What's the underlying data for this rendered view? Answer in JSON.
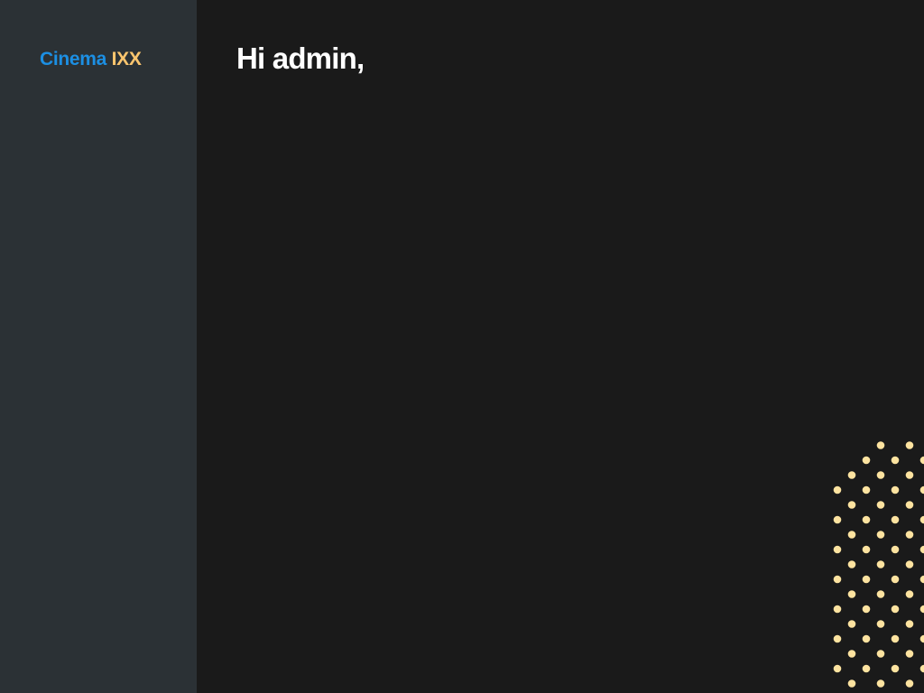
{
  "brand": {
    "name_primary": "Cinema",
    "name_accent": "IXX",
    "primary_color": "#1c8fe3",
    "accent_color": "#fbc56e"
  },
  "main": {
    "greeting": "Hi admin,"
  },
  "theme": {
    "sidebar_bg": "#2b3135",
    "main_bg": "#1a1a1a",
    "decoration_dot_color": "#fde3a0"
  }
}
